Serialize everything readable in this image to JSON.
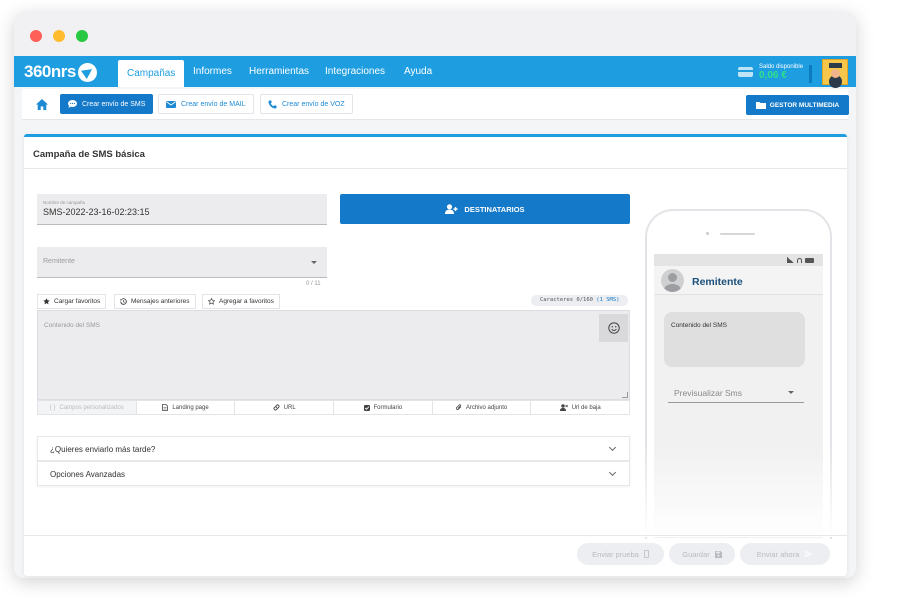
{
  "app": {
    "logo_text": "360nrs",
    "brand_color": "#1e9ee0",
    "primary_button_color": "#1479c9"
  },
  "nav": {
    "tabs": [
      {
        "label": "Campañas",
        "active": true
      },
      {
        "label": "Informes"
      },
      {
        "label": "Herramientas"
      },
      {
        "label": "Integraciones"
      },
      {
        "label": "Ayuda"
      }
    ],
    "balance_label": "Saldo disponible",
    "balance_value": "0,06 €"
  },
  "subnav": {
    "home_icon": "home-icon",
    "buttons": [
      {
        "label": "Crear envío de SMS",
        "icon": "sms-chat-icon",
        "active": true
      },
      {
        "label": "Crear envío de MAIL",
        "icon": "mail-icon"
      },
      {
        "label": "Crear envío de VOZ",
        "icon": "phone-icon"
      }
    ],
    "gestor_label": "GESTOR MULTIMEDIA"
  },
  "card": {
    "title": "Campaña de SMS básica"
  },
  "form": {
    "campaign_name_label": "Nombre de campaña",
    "campaign_name_value": "SMS-2022-23-16-02:23:15",
    "destinatarios_label": "DESTINATARIOS",
    "sender_placeholder": "Remitente",
    "sender_counter": "0 / 11",
    "tools": [
      {
        "label": "Cargar favoritos",
        "icon": "star-filled-icon"
      },
      {
        "label": "Mensajes anteriores",
        "icon": "history-icon"
      },
      {
        "label": "Agregar a favoritos",
        "icon": "star-outline-icon"
      }
    ],
    "chars_prefix": "Caracteres 0/160",
    "chars_sms": "(1 SMS)",
    "message_placeholder": "Contenido del SMS",
    "bottom_tools": [
      {
        "label": "Campos personalizados",
        "icon": "braces-icon",
        "disabled": true
      },
      {
        "label": "Landing page",
        "icon": "document-icon"
      },
      {
        "label": "URL",
        "icon": "link-icon"
      },
      {
        "label": "Formulario",
        "icon": "checkbox-icon"
      },
      {
        "label": "Archivo adjunto",
        "icon": "paperclip-icon"
      },
      {
        "label": "Url de baja",
        "icon": "user-remove-icon"
      }
    ],
    "accordion_later": "¿Quieres enviarlo más tarde?",
    "accordion_advanced": "Opciones Avanzadas"
  },
  "footer": {
    "send_test": "Enviar prueba",
    "save": "Guardar",
    "send_now": "Enviar ahora"
  },
  "phone": {
    "sender": "Remitente",
    "bubble_text": "Contenido del SMS",
    "preview_placeholder": "Previsualizar Sms"
  }
}
